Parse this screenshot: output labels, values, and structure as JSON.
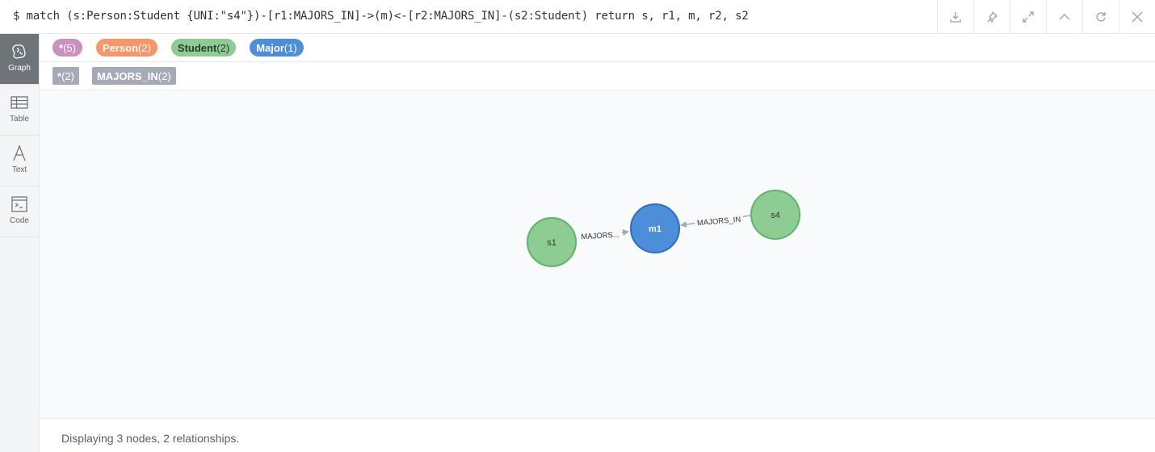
{
  "query": "$ match (s:Person:Student {UNI:\"s4\"})-[r1:MAJORS_IN]->(m)<-[r2:MAJORS_IN]-(s2:Student) return s, r1, m, r2, s2",
  "toolbar": {
    "icons": [
      "download-icon",
      "pin-icon",
      "expand-icon",
      "collapse-up-icon",
      "refresh-icon",
      "close-icon"
    ]
  },
  "sidebar": {
    "items": [
      {
        "label": "Graph",
        "icon": "graph-icon",
        "active": true
      },
      {
        "label": "Table",
        "icon": "table-icon",
        "active": false
      },
      {
        "label": "Text",
        "icon": "text-icon",
        "active": false
      },
      {
        "label": "Code",
        "icon": "code-icon",
        "active": false
      }
    ]
  },
  "node_labels": [
    {
      "name": "*",
      "count": "(5)",
      "color": "#c990c0",
      "text_color": "#ffffff"
    },
    {
      "name": "Person",
      "count": "(2)",
      "color": "#f79767",
      "text_color": "#ffffff"
    },
    {
      "name": "Student",
      "count": "(2)",
      "color": "#8dcc93",
      "text_color": "#2a3b2b"
    },
    {
      "name": "Major",
      "count": "(1)",
      "color": "#4c8eda",
      "text_color": "#ffffff"
    }
  ],
  "relationship_types": [
    {
      "name": "*",
      "count": "(2)"
    },
    {
      "name": "MAJORS_IN",
      "count": "(2)"
    }
  ],
  "graph": {
    "nodes": [
      {
        "id": "s1",
        "caption": "s1",
        "color": "#8dcc93",
        "border": "#5db665",
        "text_color": "#2a3b2b"
      },
      {
        "id": "m1",
        "caption": "m1",
        "color": "#4c8eda",
        "border": "#2870c2",
        "text_color": "#ffffff"
      },
      {
        "id": "s4",
        "caption": "s4",
        "color": "#8dcc93",
        "border": "#5db665",
        "text_color": "#2a3b2b"
      }
    ],
    "relationships": [
      {
        "from": "s1",
        "to": "m1",
        "caption": "MAJORS..."
      },
      {
        "from": "s4",
        "to": "m1",
        "caption": "MAJORS_IN"
      }
    ]
  },
  "footer": {
    "status": "Displaying 3 nodes, 2 relationships."
  }
}
